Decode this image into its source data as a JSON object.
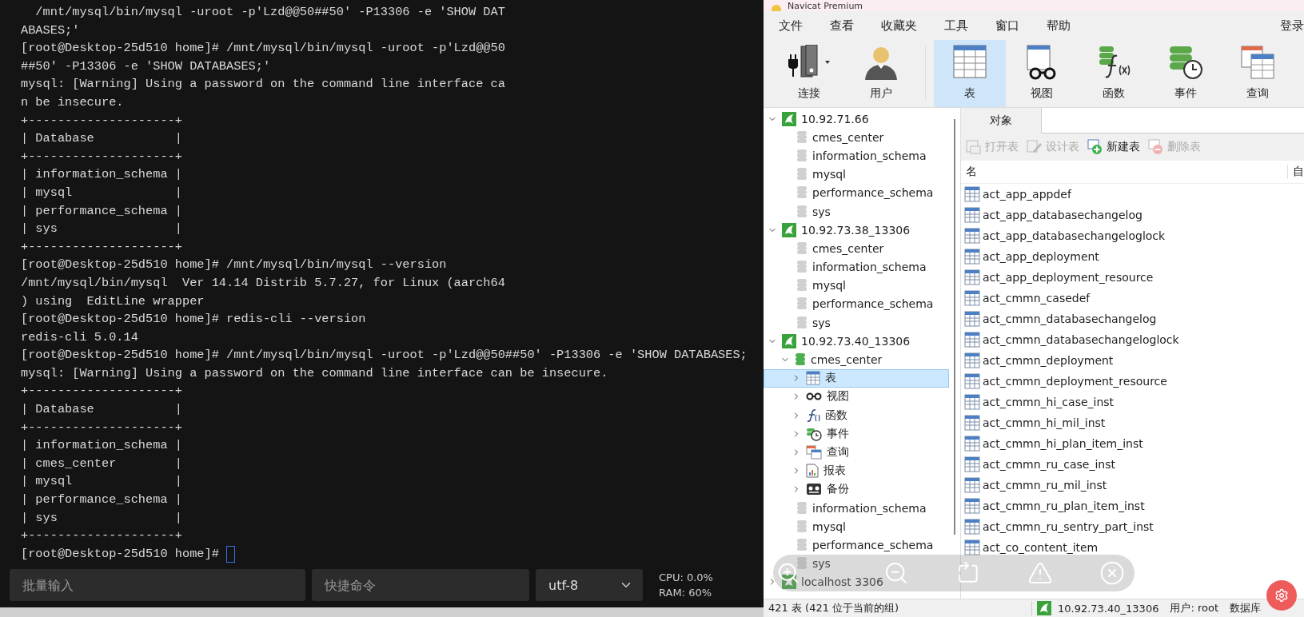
{
  "terminal": {
    "lines": [
      "  /mnt/mysql/bin/mysql -uroot -p'Lzd@@50##50' -P13306 -e 'SHOW DAT",
      "ABASES;'",
      "[root@Desktop-25d510 home]# /mnt/mysql/bin/mysql -uroot -p'Lzd@@50",
      "##50' -P13306 -e 'SHOW DATABASES;'",
      "mysql: [Warning] Using a password on the command line interface ca",
      "n be insecure.",
      "+--------------------+",
      "| Database           |",
      "+--------------------+",
      "| information_schema |",
      "| mysql              |",
      "| performance_schema |",
      "| sys                |",
      "+--------------------+",
      "[root@Desktop-25d510 home]# /mnt/mysql/bin/mysql --version",
      "/mnt/mysql/bin/mysql  Ver 14.14 Distrib 5.7.27, for Linux (aarch64",
      ") using  EditLine wrapper",
      "[root@Desktop-25d510 home]# redis-cli --version",
      "redis-cli 5.0.14",
      "[root@Desktop-25d510 home]# /mnt/mysql/bin/mysql -uroot -p'Lzd@@50##50' -P13306 -e 'SHOW DATABASES;",
      "mysql: [Warning] Using a password on the command line interface can be insecure.",
      "+--------------------+",
      "| Database           |",
      "+--------------------+",
      "| information_schema |",
      "| cmes_center        |",
      "| mysql              |",
      "| performance_schema |",
      "| sys                |",
      "+--------------------+",
      "[root@Desktop-25d510 home]# "
    ],
    "batch_input": {
      "placeholder": "批量输入"
    },
    "quick_command": {
      "placeholder": "快捷命令"
    },
    "encoding": "utf-8",
    "cpu": "CPU: 0.0%",
    "ram": "RAM: 60%"
  },
  "navicat": {
    "title": "Navicat Premium",
    "menu": [
      "文件",
      "查看",
      "收藏夹",
      "工具",
      "窗口",
      "帮助"
    ],
    "login": "登录",
    "toolbar": [
      {
        "kind": "connect",
        "label": "连接",
        "selected": false
      },
      {
        "kind": "user",
        "label": "用户",
        "selected": false
      },
      {
        "kind": "table",
        "label": "表",
        "selected": true
      },
      {
        "kind": "view",
        "label": "视图",
        "selected": false
      },
      {
        "kind": "function",
        "label": "函数",
        "selected": false
      },
      {
        "kind": "event",
        "label": "事件",
        "selected": false
      },
      {
        "kind": "query",
        "label": "查询",
        "selected": false
      }
    ],
    "connections": [
      {
        "name": "10.92.71.66",
        "expanded": true,
        "children": [
          {
            "name": "cmes_center",
            "expanded": false
          },
          {
            "name": "information_schema",
            "expanded": false
          },
          {
            "name": "mysql",
            "expanded": false
          },
          {
            "name": "performance_schema",
            "expanded": false
          },
          {
            "name": "sys",
            "expanded": false
          }
        ]
      },
      {
        "name": "10.92.73.38_13306",
        "expanded": true,
        "children": [
          {
            "name": "cmes_center",
            "expanded": false
          },
          {
            "name": "information_schema",
            "expanded": false
          },
          {
            "name": "mysql",
            "expanded": false
          },
          {
            "name": "performance_schema",
            "expanded": false
          },
          {
            "name": "sys",
            "expanded": false
          }
        ]
      },
      {
        "name": "10.92.73.40_13306",
        "expanded": true,
        "children": [
          {
            "name": "cmes_center",
            "expanded": true,
            "children": [
              {
                "kind": "table",
                "label": "表",
                "selected": true
              },
              {
                "kind": "view",
                "label": "视图",
                "selected": false
              },
              {
                "kind": "function",
                "label": "函数",
                "selected": false
              },
              {
                "kind": "event",
                "label": "事件",
                "selected": false
              },
              {
                "kind": "query",
                "label": "查询",
                "selected": false
              },
              {
                "kind": "report",
                "label": "报表",
                "selected": false
              },
              {
                "kind": "backup",
                "label": "备份",
                "selected": false
              }
            ]
          },
          {
            "name": "information_schema",
            "expanded": false
          },
          {
            "name": "mysql",
            "expanded": false
          },
          {
            "name": "performance_schema",
            "expanded": false
          },
          {
            "name": "sys",
            "expanded": false
          }
        ]
      },
      {
        "name": "localhost 3306",
        "expanded": false
      }
    ],
    "tab": {
      "label": "对象",
      "selected": true
    },
    "actions": [
      {
        "kind": "open",
        "label": "打开表",
        "disabled": true
      },
      {
        "kind": "design",
        "label": "设计表",
        "disabled": true
      },
      {
        "kind": "new",
        "label": "新建表",
        "disabled": false
      },
      {
        "kind": "delete",
        "label": "删除表",
        "disabled": true
      }
    ],
    "columns": [
      "名",
      "自"
    ],
    "tables": [
      "act_app_appdef",
      "act_app_databasechangelog",
      "act_app_databasechangeloglock",
      "act_app_deployment",
      "act_app_deployment_resource",
      "act_cmmn_casedef",
      "act_cmmn_databasechangelog",
      "act_cmmn_databasechangeloglock",
      "act_cmmn_deployment",
      "act_cmmn_deployment_resource",
      "act_cmmn_hi_case_inst",
      "act_cmmn_hi_mil_inst",
      "act_cmmn_hi_plan_item_inst",
      "act_cmmn_ru_case_inst",
      "act_cmmn_ru_mil_inst",
      "act_cmmn_ru_plan_item_inst",
      "act_cmmn_ru_sentry_part_inst",
      "act_co_content_item"
    ],
    "status": {
      "count": "421 表 (421 位于当前的组)",
      "connection": "10.92.73.40_13306",
      "user": "用户: root",
      "database": "数据库"
    }
  }
}
